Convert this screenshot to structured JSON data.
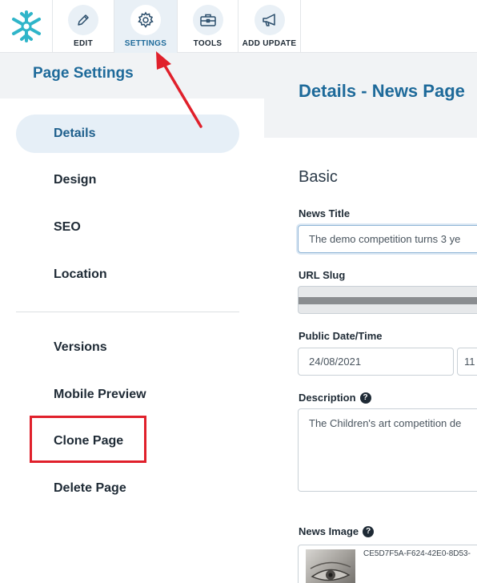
{
  "toolbar": {
    "tools": [
      {
        "label": "EDIT",
        "icon": "pencil-icon"
      },
      {
        "label": "SETTINGS",
        "icon": "gear-icon"
      },
      {
        "label": "TOOLS",
        "icon": "toolbox-icon"
      },
      {
        "label": "ADD UPDATE",
        "icon": "megaphone-icon"
      }
    ],
    "active": "SETTINGS",
    "logo_icon": "snowflake-logo-icon"
  },
  "sidebar": {
    "title": "Page Settings",
    "items": [
      {
        "label": "Details",
        "active": true
      },
      {
        "label": "Design"
      },
      {
        "label": "SEO"
      },
      {
        "label": "Location"
      },
      {
        "label": "Versions"
      },
      {
        "label": "Mobile Preview"
      },
      {
        "label": "Clone Page"
      },
      {
        "label": "Delete Page"
      }
    ]
  },
  "main": {
    "title": "Details - News Page",
    "section": "Basic",
    "fields": {
      "news_title_label": "News Title",
      "news_title_value": "The demo competition turns 3 ye",
      "url_slug_label": "URL Slug",
      "public_date_label": "Public Date/Time",
      "public_date_value": "24/08/2021",
      "public_time_value": "11",
      "description_label": "Description",
      "description_value": "The Children's art competition de",
      "news_image_label": "News Image",
      "news_image_name": "CE5D7F5A-F624-42E0-8D53-",
      "help_glyph": "?"
    }
  },
  "colors": {
    "accent": "#1e6a9a",
    "annotation_red": "#e0202b",
    "panel_bg": "#f1f3f5"
  }
}
